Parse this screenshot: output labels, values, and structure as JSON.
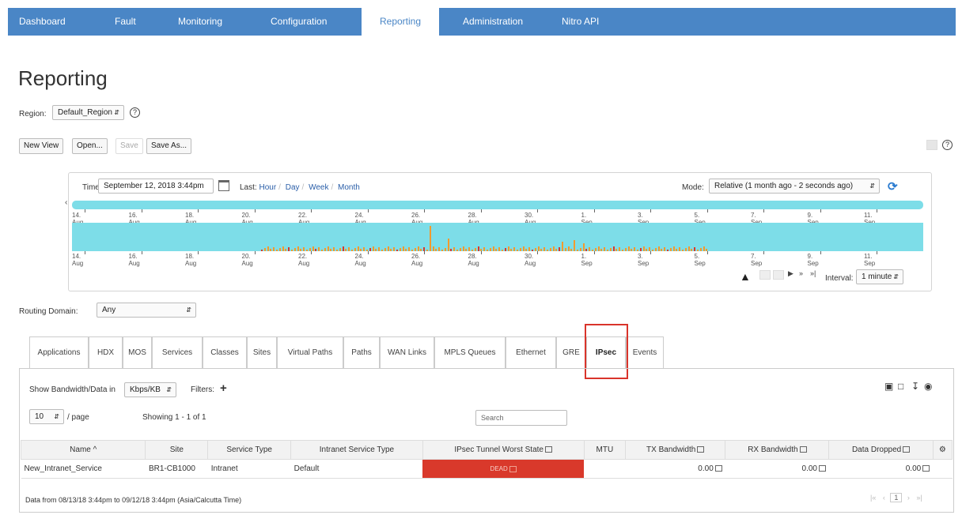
{
  "nav": {
    "tabs": [
      "Dashboard",
      "Fault",
      "Monitoring",
      "Configuration",
      "Reporting",
      "Administration",
      "Nitro API"
    ],
    "active": "Reporting",
    "color": "#4a86c6"
  },
  "page": {
    "title": "Reporting"
  },
  "region": {
    "label": "Region:",
    "value": "Default_Region"
  },
  "view_buttons": {
    "new_view": "New View",
    "open": "Open...",
    "save": "Save",
    "save_as": "Save As..."
  },
  "time": {
    "label": "Time:",
    "value": "September 12, 2018 3:44pm",
    "last_label": "Last:",
    "quick": [
      "Hour",
      "Day",
      "Week",
      "Month"
    ],
    "mode_label": "Mode:",
    "mode_value": "Relative (1 month ago - 2 seconds ago)",
    "interval_label": "Interval:",
    "interval_value": "1 minute",
    "axis_labels": [
      "14. Aug",
      "16. Aug",
      "18. Aug",
      "20. Aug",
      "22. Aug",
      "24. Aug",
      "26. Aug",
      "28. Aug",
      "30. Aug",
      "1. Sep",
      "3. Sep",
      "5. Sep",
      "7. Sep",
      "9. Sep",
      "11. Sep"
    ]
  },
  "routing_domain": {
    "label": "Routing Domain:",
    "value": "Any"
  },
  "tabs": [
    "Applications",
    "HDX",
    "MOS",
    "Services",
    "Classes",
    "Sites",
    "Virtual Paths",
    "Paths",
    "WAN Links",
    "MPLS Queues",
    "Ethernet",
    "GRE",
    "IPsec",
    "Events"
  ],
  "active_tab": "IPsec",
  "toolbar": {
    "bandwidth_label": "Show Bandwidth/Data in",
    "bandwidth_value": "Kbps/KB",
    "filters_label": "Filters:",
    "per_page_value": "10",
    "per_page_label": "/ page",
    "showing": "Showing 1 - 1 of 1",
    "search_placeholder": "Search"
  },
  "table": {
    "headers": [
      "Name ^",
      "Site",
      "Service Type",
      "Intranet Service Type",
      "IPsec Tunnel Worst State",
      "MTU",
      "TX Bandwidth",
      "RX Bandwidth",
      "Data Dropped"
    ],
    "rows": [
      [
        "New_Intranet_Service",
        "BR1-CB1000",
        "Intranet",
        "Default",
        "DEAD",
        "",
        "0.00",
        "0.00",
        "0.00"
      ]
    ]
  },
  "footer": {
    "text": "Data from 08/13/18 3:44pm to 09/12/18 3:44pm (Asia/Calcutta Time)",
    "page": "1"
  }
}
